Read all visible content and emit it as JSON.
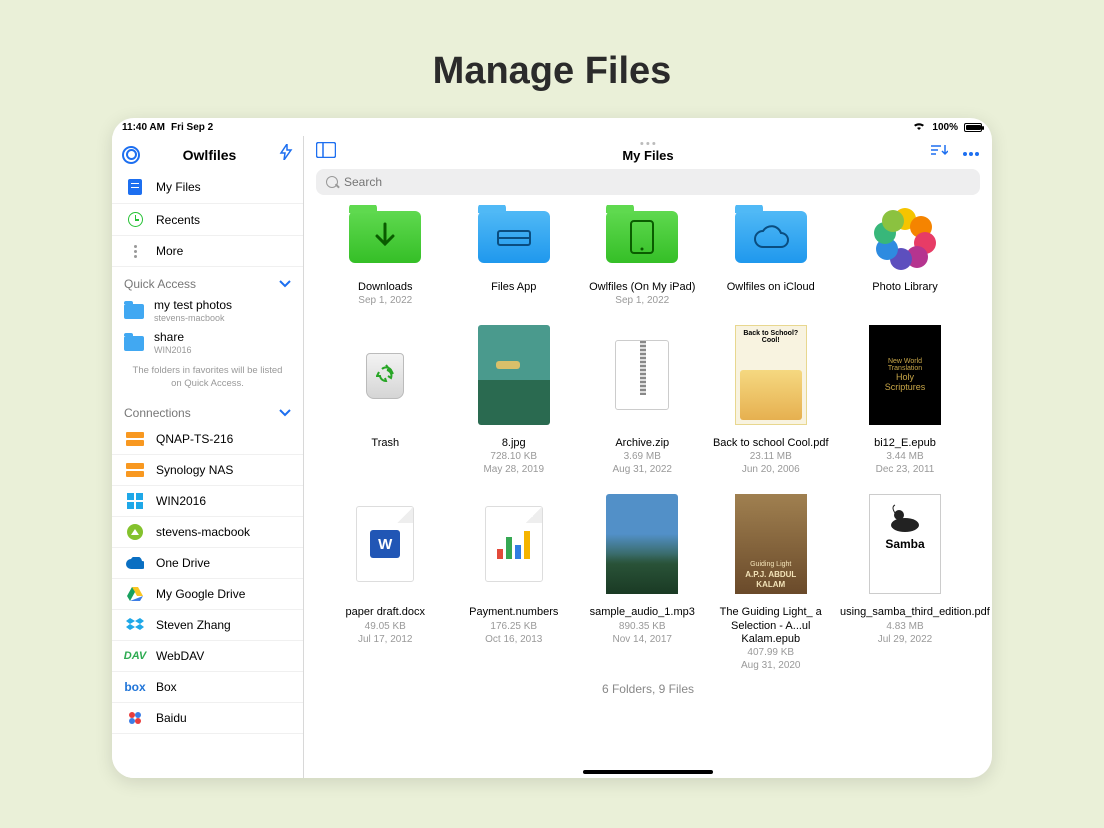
{
  "page_title": "Manage Files",
  "statusbar": {
    "time": "11:40 AM",
    "date": "Fri Sep 2",
    "battery": "100%"
  },
  "sidebar": {
    "app_name": "Owlfiles",
    "nav": {
      "my_files": "My Files",
      "recents": "Recents",
      "more": "More"
    },
    "quick_access": {
      "header": "Quick Access",
      "items": [
        {
          "name": "my test photos",
          "sub": "stevens-macbook"
        },
        {
          "name": "share",
          "sub": "WIN2016"
        }
      ],
      "note": "The folders in favorites will be listed on Quick Access."
    },
    "connections": {
      "header": "Connections",
      "items": [
        {
          "name": "QNAP-TS-216",
          "icon": "nas-orange"
        },
        {
          "name": "Synology NAS",
          "icon": "nas-orange"
        },
        {
          "name": "WIN2016",
          "icon": "windows"
        },
        {
          "name": "stevens-macbook",
          "icon": "mac-green"
        },
        {
          "name": "One Drive",
          "icon": "onedrive"
        },
        {
          "name": "My Google Drive",
          "icon": "gdrive"
        },
        {
          "name": "Steven Zhang",
          "icon": "dropbox"
        },
        {
          "name": "WebDAV",
          "icon": "webdav"
        },
        {
          "name": "Box",
          "icon": "box"
        },
        {
          "name": "Baidu",
          "icon": "baidu"
        }
      ]
    }
  },
  "content": {
    "title": "My Files",
    "search_placeholder": "Search",
    "footer": "6 Folders, 9 Files",
    "items": [
      {
        "name": "Downloads",
        "sub1": "Sep 1, 2022",
        "sub2": "",
        "kind": "folder-green-download"
      },
      {
        "name": "Files App",
        "sub1": "",
        "sub2": "",
        "kind": "folder-blue-files"
      },
      {
        "name": "Owlfiles (On My iPad)",
        "sub1": "Sep 1, 2022",
        "sub2": "",
        "kind": "folder-green-ipad"
      },
      {
        "name": "Owlfiles on iCloud",
        "sub1": "",
        "sub2": "",
        "kind": "folder-blue-cloud"
      },
      {
        "name": "Photo Library",
        "sub1": "",
        "sub2": "",
        "kind": "photos"
      },
      {
        "name": "Trash",
        "sub1": "",
        "sub2": "",
        "kind": "trash"
      },
      {
        "name": "8.jpg",
        "sub1": "728.10 KB",
        "sub2": "May 28, 2019",
        "kind": "image1"
      },
      {
        "name": "Archive.zip",
        "sub1": "3.69 MB",
        "sub2": "Aug 31, 2022",
        "kind": "zip"
      },
      {
        "name": "Back to school Cool.pdf",
        "sub1": "23.11 MB",
        "sub2": "Jun 20, 2006",
        "kind": "book-bts"
      },
      {
        "name": "bi12_E.epub",
        "sub1": "3.44 MB",
        "sub2": "Dec 23, 2011",
        "kind": "book-black"
      },
      {
        "name": "paper draft.docx",
        "sub1": "49.05 KB",
        "sub2": "Jul 17, 2012",
        "kind": "word"
      },
      {
        "name": "Payment.numbers",
        "sub1": "176.25 KB",
        "sub2": "Oct 16, 2013",
        "kind": "numbers"
      },
      {
        "name": "sample_audio_1.mp3",
        "sub1": "890.35 KB",
        "sub2": "Nov 14, 2017",
        "kind": "image2"
      },
      {
        "name": "The Guiding Light_ a Selection - A...ul Kalam.epub",
        "sub1": "407.99 KB",
        "sub2": "Aug 31, 2020",
        "kind": "book-kalam"
      },
      {
        "name": "using_samba_third_edition.pdf",
        "sub1": "4.83 MB",
        "sub2": "Jul 29, 2022",
        "kind": "book-samba"
      }
    ]
  }
}
